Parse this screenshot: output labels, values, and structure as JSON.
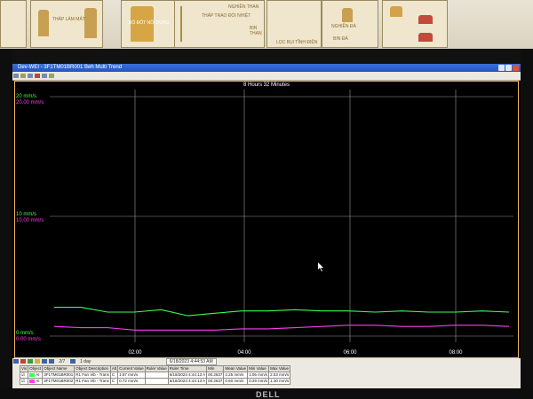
{
  "window": {
    "title": "Dev-WEI - 3F1TM01BR001 Beh Multi Trend"
  },
  "poster": {
    "labels": [
      "THÁP LÀM MÁT",
      "THÁP TRAO ĐỔI NHIỆT",
      "BỘ ĐỐT NỘI DUNG",
      "NGHIỀN THAN",
      "BIN THAN",
      "LỌC BỤI TĨNH ĐIỆN",
      "NGHIỀN ĐÁ",
      "BIN ĐÁ"
    ]
  },
  "trend": {
    "duration": "8 Hours 32 Minutes",
    "y_labels": {
      "green_top": "20 mm/s",
      "magenta_top": "20.00 mm/s",
      "green_mid": "10 mm/s",
      "magenta_mid": "10.00 mm/s",
      "green_bottom": "0 mm/s",
      "magenta_bottom": "0.00 mm/s"
    },
    "x_labels": [
      "02:00",
      "04:00",
      "06:00",
      "08:00"
    ],
    "colors": {
      "green": "#3bff4a",
      "magenta": "#ff3cf0",
      "grid": "#9a9a9a",
      "frame": "#f0b85a"
    }
  },
  "chart_data": {
    "type": "line",
    "x": [
      "00:40",
      "01:00",
      "01:30",
      "02:00",
      "02:30",
      "03:00",
      "03:30",
      "04:00",
      "04:30",
      "05:00",
      "05:30",
      "06:00",
      "06:30",
      "07:00",
      "07:30",
      "08:00",
      "08:30",
      "09:00"
    ],
    "ylim": [
      0,
      20
    ],
    "series": [
      {
        "values": [
          2.4,
          2.4,
          2.0,
          2.0,
          2.2,
          1.7,
          1.9,
          2.1,
          2.1,
          2.2,
          2.1,
          2.1,
          2.0,
          2.1,
          2.0,
          2.0,
          2.1,
          2.0
        ]
      },
      {
        "values": [
          0.8,
          0.7,
          0.7,
          0.5,
          0.5,
          0.5,
          0.5,
          0.6,
          0.6,
          0.7,
          0.8,
          0.9,
          0.9,
          0.8,
          0.8,
          0.9,
          0.9,
          0.8
        ]
      }
    ]
  },
  "table": {
    "toolbar": {
      "page_info": "2/7",
      "time_span": "1 day",
      "timestamp": "6/18/2023 4:44:53 AM"
    },
    "headers": [
      "Vis",
      "Object",
      "Object Name",
      "Object Description",
      "Alt",
      "Current Value",
      "Ruler Value",
      "Ruler Time",
      "Min",
      "Mean Value",
      "Min Value",
      "Max Value"
    ],
    "rows": [
      {
        "vis": "☑",
        "object": "AI",
        "name": "3F1TM01BR001",
        "description": "R1 Fan Vib - Trans",
        "alt": "C",
        "current": "1.87 mm/s",
        "ruler_value": "",
        "ruler_time": "6/18/2023 4:44:13 A",
        "min": "00.2637",
        "mean": "2.25 mm/s",
        "min_value": "1.05 mm/s",
        "max_value": "2.53 mm/s",
        "color": "#3bff4a"
      },
      {
        "vis": "☑",
        "object": "AI",
        "name": "3F1TM01BR002",
        "description": "R1 Fan Vib - Trans",
        "alt": "C",
        "current": "0.72 mm/s",
        "ruler_value": "",
        "ruler_time": "6/18/2023 4:44:13 A",
        "min": "00.2637",
        "mean": "0.60 mm/s",
        "min_value": "0.29 mm/s",
        "max_value": "1.30 mm/s",
        "color": "#ff3cf0"
      }
    ]
  },
  "brand": "DELL"
}
